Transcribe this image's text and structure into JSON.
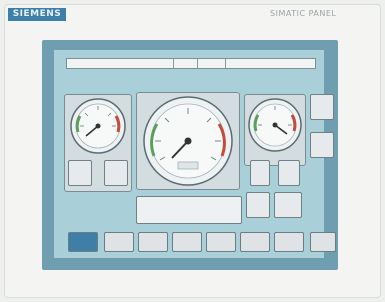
{
  "device": {
    "brand": "SIEMENS",
    "model": "SIMATIC PANEL"
  },
  "header": {
    "field1": "",
    "field2": "",
    "field3": "",
    "field4": ""
  },
  "center_readout": {
    "value": "",
    "unit": ""
  },
  "colors": {
    "bezel": "#6f9eb0",
    "screen": "#a9cfd9",
    "logo": "#3d7fa8",
    "active_nav": "#3f7ea6",
    "gauge_green": "#5aa05a",
    "gauge_red": "#c84a3a"
  },
  "icons": [
    "gauge-icon",
    "needle-icon"
  ]
}
